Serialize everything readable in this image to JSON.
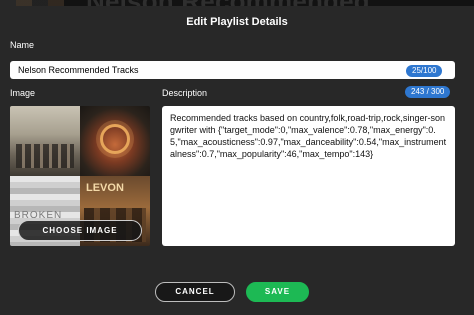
{
  "background": {
    "title": "Nelson Recommended"
  },
  "modal": {
    "title": "Edit Playlist Details",
    "name_label": "Name",
    "name_value": "Nelson Recommended Tracks",
    "name_counter": "25/100",
    "image_label": "Image",
    "image_art_texts": [
      "BROKEN",
      "LEVON"
    ],
    "choose_image_label": "CHOOSE IMAGE",
    "description_label": "Description",
    "description_counter": "243 / 300",
    "description_value": "Recommended tracks based on country,folk,road-trip,rock,singer-songwriter with {\"target_mode\":0,\"max_valence\":0.78,\"max_energy\":0.5,\"max_acousticness\":0.97,\"max_danceability\":0.54,\"max_instrumentalness\":0.7,\"max_popularity\":46,\"max_tempo\":143}",
    "cancel_label": "CANCEL",
    "save_label": "SAVE"
  },
  "colors": {
    "accent_blue": "#2e77d0",
    "save_green": "#1db954",
    "modal_bg": "#282828"
  }
}
